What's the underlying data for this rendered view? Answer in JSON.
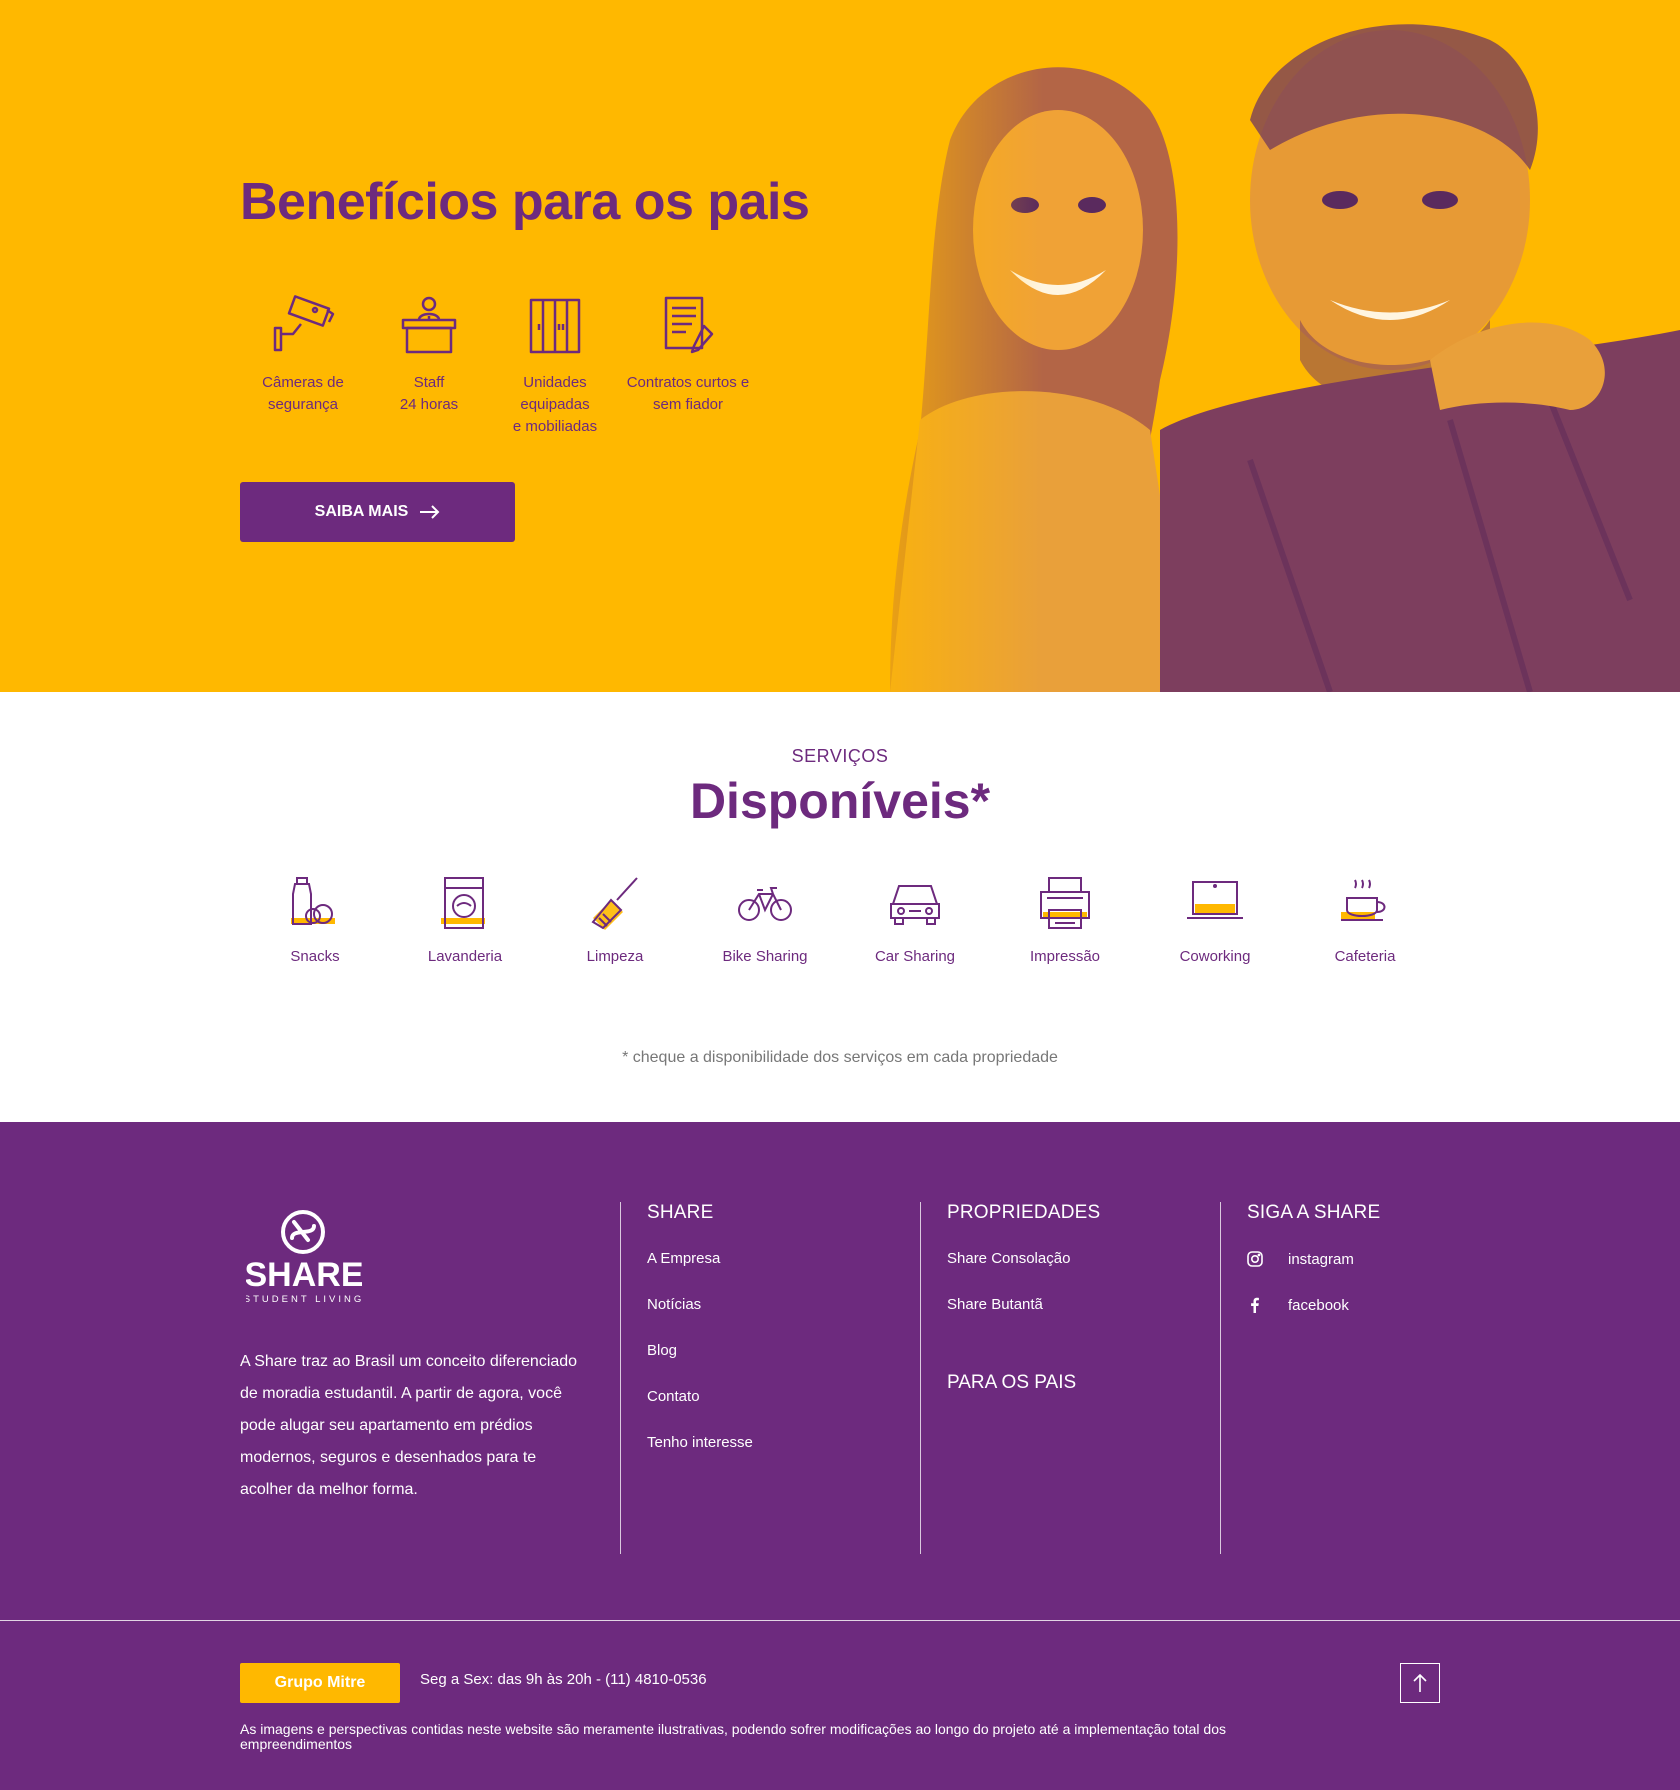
{
  "hero": {
    "title": "Benefícios para os pais",
    "benefits": [
      {
        "icon": "security-camera-icon",
        "label": "Câmeras de\nsegurança"
      },
      {
        "icon": "reception-staff-icon",
        "label": "Staff\n24 horas"
      },
      {
        "icon": "wardrobe-icon",
        "label": "Unidades\nequipadas\ne mobiliadas"
      },
      {
        "icon": "contract-icon",
        "label": "Contratos curtos e\nsem fiador"
      }
    ],
    "button_label": "SAIBA MAIS",
    "photo_alt": "smiling-couple-photo"
  },
  "services": {
    "kicker": "SERVIÇOS",
    "title": "Disponíveis*",
    "items": [
      {
        "icon": "snacks-icon",
        "label": "Snacks"
      },
      {
        "icon": "washing-machine-icon",
        "label": "Lavanderia"
      },
      {
        "icon": "broom-icon",
        "label": "Limpeza"
      },
      {
        "icon": "bicycle-icon",
        "label": "Bike Sharing"
      },
      {
        "icon": "car-icon",
        "label": "Car Sharing"
      },
      {
        "icon": "printer-icon",
        "label": "Impressão"
      },
      {
        "icon": "laptop-icon",
        "label": "Coworking"
      },
      {
        "icon": "coffee-cup-icon",
        "label": "Cafeteria"
      }
    ],
    "note": "* cheque a disponibilidade dos serviços em cada propriedade"
  },
  "footer": {
    "logo_text": "SHARE",
    "logo_subtext": "STUDENT LIVING",
    "about": "A Share traz ao Brasil um conceito diferenciado de moradia estudantil. A partir de agora, você pode alugar seu apartamento em prédios modernos, seguros e desenhados para te acolher da melhor forma.",
    "share_heading": "SHARE",
    "share_links": [
      "A Empresa",
      "Notícias",
      "Blog",
      "Contato",
      "Tenho interesse"
    ],
    "props_heading": "PROPRIEDADES",
    "props_links": [
      "Share Consolação",
      "Share Butantã"
    ],
    "parents_heading": "PARA OS PAIS",
    "social_heading": "SIGA A SHARE",
    "social_links": [
      {
        "icon": "instagram-icon",
        "label": "instagram"
      },
      {
        "icon": "facebook-icon",
        "label": "facebook"
      }
    ],
    "mitre_button": "Grupo Mitre",
    "hours": "Seg a Sex: das 9h às 20h - (11) 4810-0536",
    "disclaimer": "As imagens e perspectivas contidas neste website são meramente ilustrativas, podendo sofrer modificações ao longo do projeto até a implementação total dos empreendimentos"
  },
  "colors": {
    "brand_purple": "#6d2a7e",
    "brand_yellow": "#ffb800"
  }
}
